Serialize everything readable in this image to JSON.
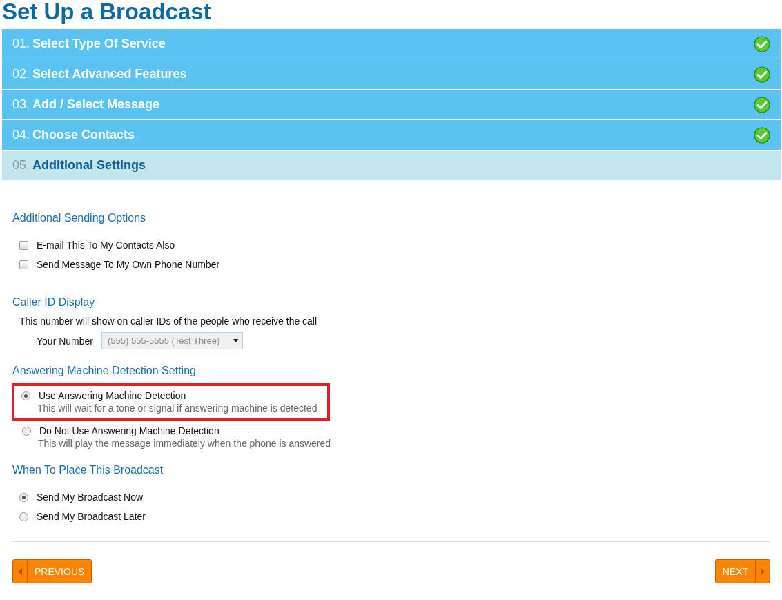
{
  "title": "Set Up a Broadcast",
  "steps": [
    {
      "number": "01.",
      "label": "Select Type Of Service",
      "completed": true,
      "active": false
    },
    {
      "number": "02.",
      "label": "Select Advanced Features",
      "completed": true,
      "active": false
    },
    {
      "number": "03.",
      "label": "Add / Select Message",
      "completed": true,
      "active": false
    },
    {
      "number": "04.",
      "label": "Choose Contacts",
      "completed": true,
      "active": false
    },
    {
      "number": "05.",
      "label": "Additional Settings",
      "completed": false,
      "active": true
    }
  ],
  "sections": [
    {
      "kind": "checkboxes",
      "heading": "Additional Sending Options",
      "options": [
        {
          "label": "E-mail This To My Contacts Also",
          "checked": false
        },
        {
          "label": "Send Message To My Own Phone Number",
          "checked": false
        }
      ]
    },
    {
      "kind": "select",
      "heading": "Caller ID Display",
      "description": "This number will show on caller IDs of the people who receive the call",
      "field_label": "Your Number",
      "value": "(555) 555-5555 (Test Three)"
    },
    {
      "kind": "radios",
      "heading": "Answering Machine Detection Setting",
      "options": [
        {
          "label": "Use Answering Machine Detection",
          "description": "This will wait for a tone or signal if answering machine is detected",
          "selected": true,
          "highlighted": true
        },
        {
          "label": "Do Not Use Answering Machine Detection",
          "description": "This will play the message immediately when the phone is answered",
          "selected": false,
          "highlighted": false
        }
      ]
    },
    {
      "kind": "radios",
      "heading": "When To Place This Broadcast",
      "options": [
        {
          "label": "Send My Broadcast Now",
          "selected": true
        },
        {
          "label": "Send My Broadcast Later",
          "selected": false
        }
      ]
    }
  ],
  "buttons": [
    {
      "kind": "previous",
      "label": "PREVIOUS"
    },
    {
      "kind": "next",
      "label": "NEXT"
    }
  ]
}
